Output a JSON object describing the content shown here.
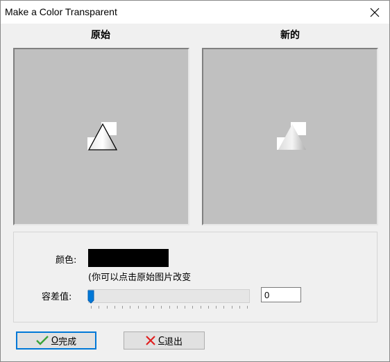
{
  "window": {
    "title": "Make a Color Transparent"
  },
  "panels": {
    "original_label": "原始",
    "new_label": "新的"
  },
  "color_field": {
    "label": "颜色:",
    "value_color": "#000000",
    "hint": "(你可以点击原始图片改变"
  },
  "tolerance": {
    "label": "容差值:",
    "value": "0",
    "min": 0,
    "max": 100,
    "position": 0
  },
  "buttons": {
    "ok_hotkey": "O",
    "ok_label": "完成",
    "cancel_hotkey": "C",
    "cancel_label": "退出"
  },
  "colors": {
    "preview_bg": "#c0c0c0",
    "accent": "#0078d7",
    "ok_icon": "#3aa33a",
    "cancel_icon": "#e02020"
  },
  "icons": {
    "close": "close-icon",
    "ok": "checkmark-icon",
    "cancel": "x-icon",
    "image": "cone-icon"
  }
}
